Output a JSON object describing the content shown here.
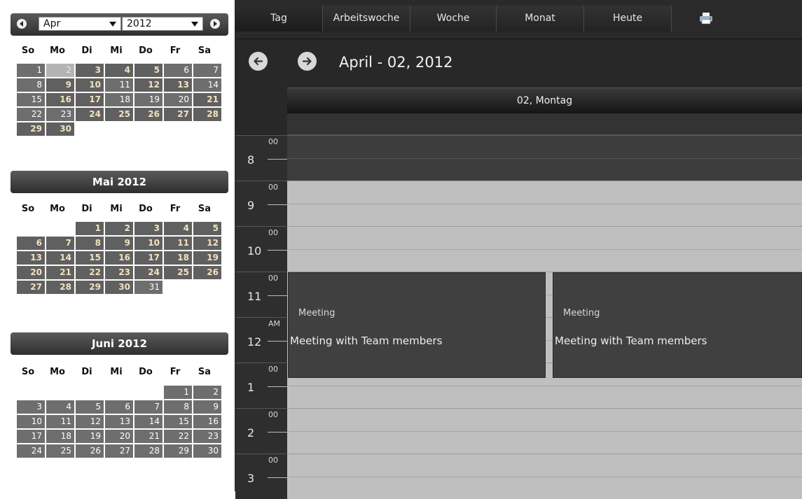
{
  "mini_nav": {
    "month_value": "Apr",
    "year_value": "2012"
  },
  "weekdays": [
    "So",
    "Mo",
    "Di",
    "Mi",
    "Do",
    "Fr",
    "Sa"
  ],
  "months": [
    {
      "title": "",
      "days": [
        "1",
        "2",
        "3",
        "4",
        "5",
        "6",
        "7",
        "8",
        "9",
        "10",
        "11",
        "12",
        "13",
        "14",
        "15",
        "16",
        "17",
        "18",
        "19",
        "20",
        "21",
        "22",
        "23",
        "24",
        "25",
        "26",
        "27",
        "28",
        "29",
        "30"
      ]
    },
    {
      "title": "Mai 2012",
      "days": [
        "1",
        "2",
        "3",
        "4",
        "5",
        "6",
        "7",
        "8",
        "9",
        "10",
        "11",
        "12",
        "13",
        "14",
        "15",
        "16",
        "17",
        "18",
        "19",
        "20",
        "21",
        "22",
        "23",
        "24",
        "25",
        "26",
        "27",
        "28",
        "29",
        "30",
        "31"
      ]
    },
    {
      "title": "Juni 2012",
      "days": [
        "1",
        "2",
        "3",
        "4",
        "5",
        "6",
        "7",
        "8",
        "9",
        "10",
        "11",
        "12",
        "13",
        "14",
        "15",
        "16",
        "17",
        "18",
        "19",
        "20",
        "21",
        "22",
        "23",
        "24",
        "25",
        "26",
        "27",
        "28",
        "29",
        "30"
      ]
    }
  ],
  "views": {
    "day": "Tag",
    "workweek": "Arbeitswoche",
    "week": "Woche",
    "month": "Monat",
    "today": "Heute"
  },
  "headline": "April - 02, 2012",
  "day_header": "02, Montag",
  "hours": [
    {
      "num": "8",
      "sub": "00"
    },
    {
      "num": "9",
      "sub": "00"
    },
    {
      "num": "10",
      "sub": "00"
    },
    {
      "num": "11",
      "sub": "00"
    },
    {
      "num": "12",
      "sub": "AM"
    },
    {
      "num": "1",
      "sub": "00"
    },
    {
      "num": "2",
      "sub": "00"
    },
    {
      "num": "3",
      "sub": "00"
    }
  ],
  "events": [
    {
      "type": "Meeting",
      "title": "Meeting with Team members"
    },
    {
      "type": "Meeting",
      "title": "Meeting with Team members"
    }
  ]
}
